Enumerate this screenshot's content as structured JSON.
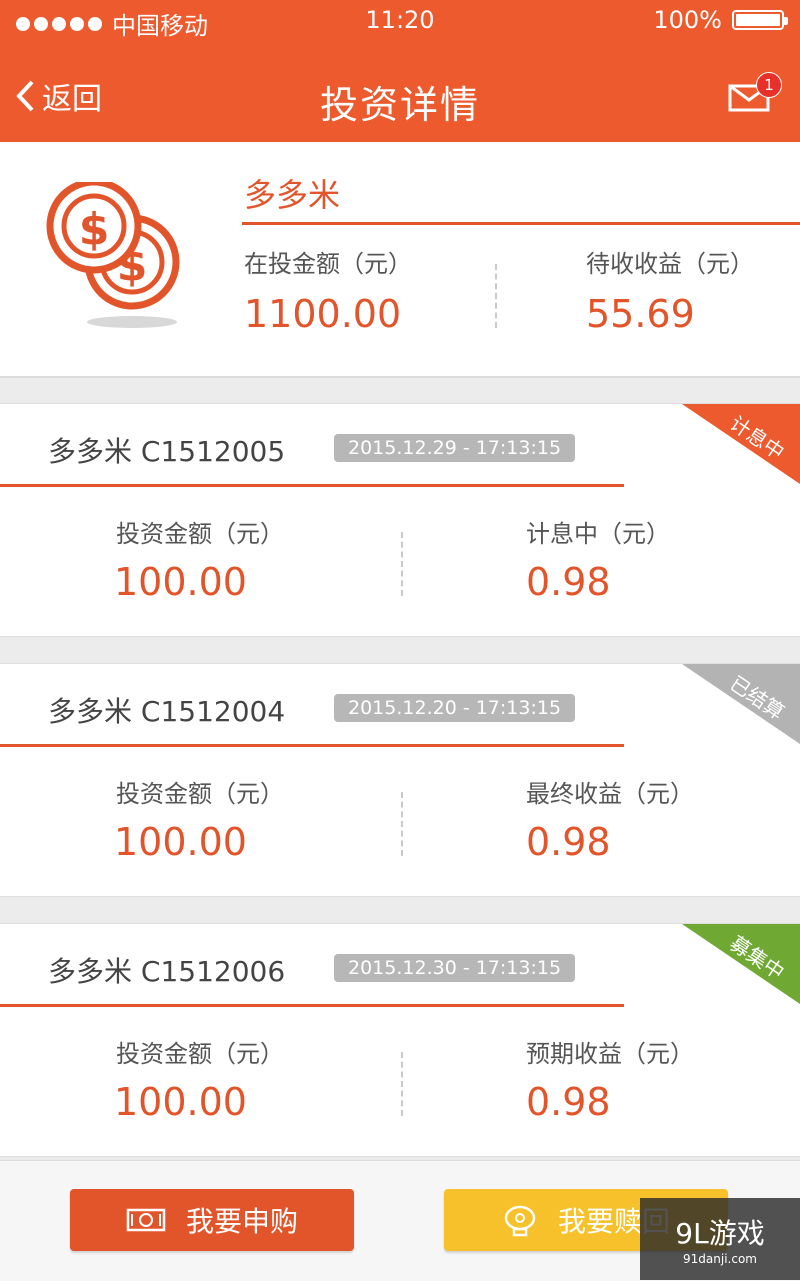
{
  "status_bar": {
    "carrier": "中国移动",
    "time": "11:20",
    "battery": "100%"
  },
  "nav": {
    "back_label": "返回",
    "title": "投资详情",
    "mail_badge": "1"
  },
  "summary": {
    "product_name": "多多米",
    "invested_label": "在投金额（元）",
    "invested_value": "1100.00",
    "pending_label": "待收收益（元）",
    "pending_value": "55.69"
  },
  "cards": [
    {
      "name": "多多米 C1512005",
      "date": "2015.12.29 - 17:13:15",
      "amount_label": "投资金额（元）",
      "amount": "100.00",
      "return_label": "计息中（元）",
      "return_value": "0.98",
      "status": "计息中",
      "status_color": "#ec5a2e"
    },
    {
      "name": "多多米 C1512004",
      "date": "2015.12.20 - 17:13:15",
      "amount_label": "投资金额（元）",
      "amount": "100.00",
      "return_label": "最终收益（元）",
      "return_value": "0.98",
      "status": "已结算",
      "status_color": "#b3b3b3"
    },
    {
      "name": "多多米 C1512006",
      "date": "2015.12.30 - 17:13:15",
      "amount_label": "投资金额（元）",
      "amount": "100.00",
      "return_label": "预期收益（元）",
      "return_value": "0.98",
      "status": "募集中",
      "status_color": "#6fa832"
    }
  ],
  "actions": {
    "buy_label": "我要申购",
    "redeem_label": "我要赎回"
  },
  "watermark": {
    "logo": "9L游戏",
    "site": "91danji.com"
  },
  "colors": {
    "brand": "#ec5a2e",
    "accent_text": "#e2552b",
    "redeem": "#f6c12a"
  }
}
